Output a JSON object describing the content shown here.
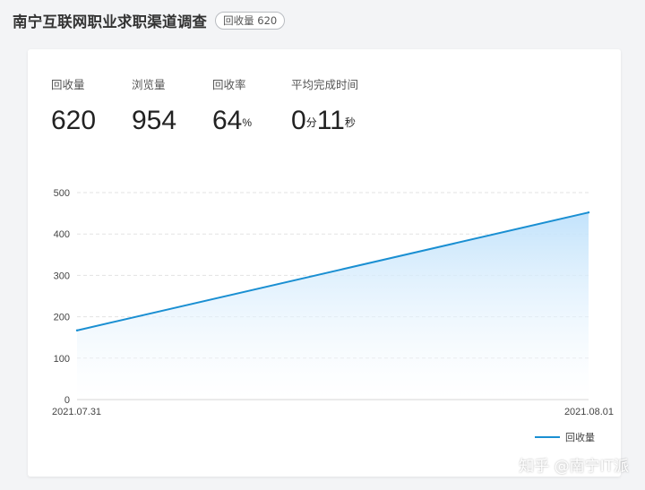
{
  "header": {
    "title": "南宁互联网职业求职渠道调查",
    "badge": "回收量 620"
  },
  "stats": {
    "recovered": {
      "label": "回收量",
      "value": "620"
    },
    "views": {
      "label": "浏览量",
      "value": "954"
    },
    "rate": {
      "label": "回收率",
      "value": "64",
      "unit": "%"
    },
    "avg_time": {
      "label": "平均完成时间",
      "min": "0",
      "min_unit": "分",
      "sec": "11",
      "sec_unit": "秒"
    }
  },
  "colors": {
    "line": "#1a8fd2",
    "area_top": "#bfe1fb",
    "grid": "#e3e3e3"
  },
  "chart_data": {
    "type": "area",
    "x": [
      "2021.07.31",
      "2021.08.01"
    ],
    "series": [
      {
        "name": "回收量",
        "values": [
          167,
          452
        ]
      }
    ],
    "ylim": [
      0,
      500
    ],
    "yticks": [
      0,
      100,
      200,
      300,
      400,
      500
    ],
    "grid": true,
    "legend": "bottom-right"
  },
  "watermark": "知乎 @南宁IT派"
}
